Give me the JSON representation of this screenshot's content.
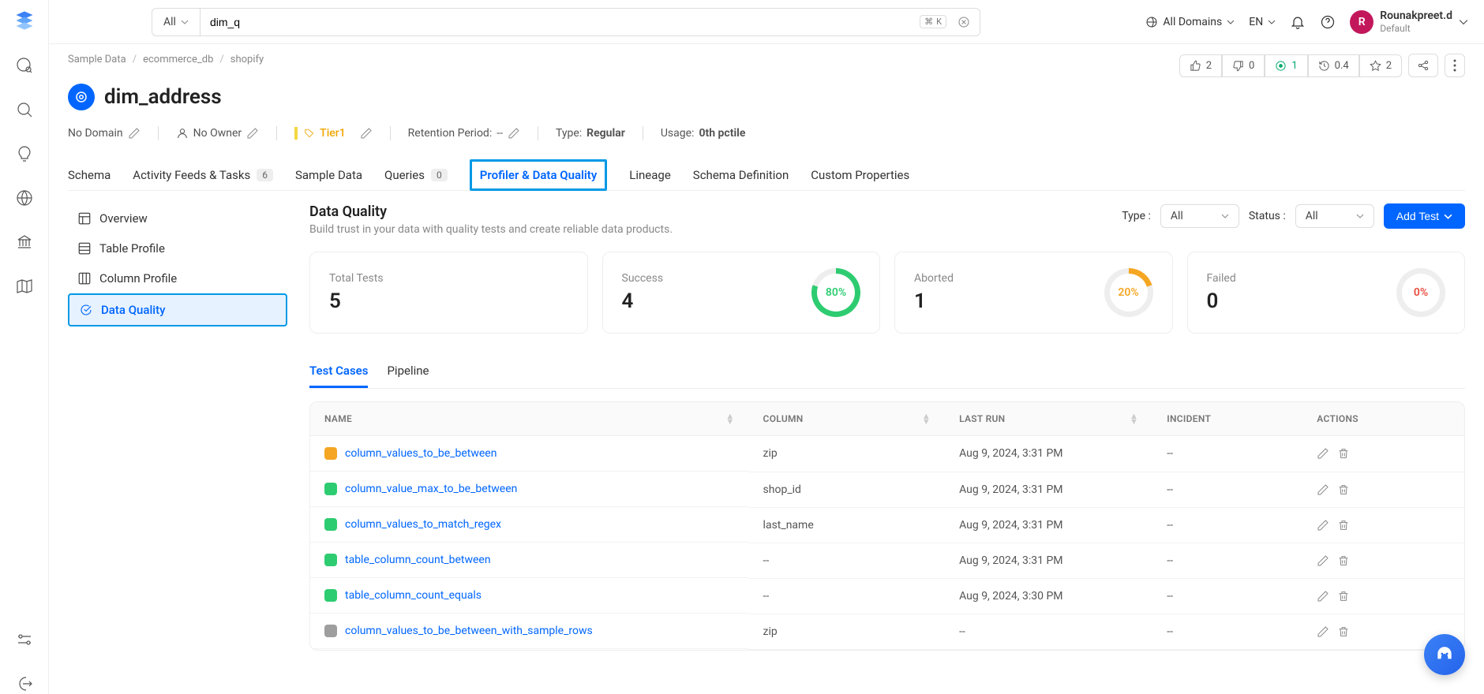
{
  "topbar": {
    "search_scope": "All",
    "search_value": "dim_q",
    "domains_label": "All Domains",
    "lang": "EN",
    "user_name": "Rounakpreet.d",
    "user_role": "Default",
    "user_initial": "R"
  },
  "breadcrumb": [
    "Sample Data",
    "ecommerce_db",
    "shopify"
  ],
  "entity": {
    "name": "dim_address",
    "domain": "No Domain",
    "owner": "No Owner",
    "tier": "Tier1",
    "retention_label": "Retention Period:",
    "retention_value": "--",
    "type_label": "Type:",
    "type_value": "Regular",
    "usage_label": "Usage:",
    "usage_value": "0th pctile"
  },
  "header_stats": {
    "thumbs_up": "2",
    "thumbs_down": "0",
    "target": "1",
    "history": "0.4",
    "star": "2"
  },
  "tabs": [
    {
      "label": "Schema"
    },
    {
      "label": "Activity Feeds & Tasks",
      "badge": "6"
    },
    {
      "label": "Sample Data"
    },
    {
      "label": "Queries",
      "badge": "0"
    },
    {
      "label": "Profiler & Data Quality",
      "active": true
    },
    {
      "label": "Lineage"
    },
    {
      "label": "Schema Definition"
    },
    {
      "label": "Custom Properties"
    }
  ],
  "side_nav": [
    {
      "label": "Overview"
    },
    {
      "label": "Table Profile"
    },
    {
      "label": "Column Profile"
    },
    {
      "label": "Data Quality",
      "active": true
    }
  ],
  "dq": {
    "title": "Data Quality",
    "subtitle": "Build trust in your data with quality tests and create reliable data products.",
    "type_label": "Type :",
    "type_value": "All",
    "status_label": "Status :",
    "status_value": "All",
    "add_test": "Add Test"
  },
  "cards": {
    "total_label": "Total Tests",
    "total_value": "5",
    "success_label": "Success",
    "success_value": "4",
    "success_pct": "80%",
    "aborted_label": "Aborted",
    "aborted_value": "1",
    "aborted_pct": "20%",
    "failed_label": "Failed",
    "failed_value": "0",
    "failed_pct": "0%"
  },
  "sub_tabs": [
    "Test Cases",
    "Pipeline"
  ],
  "table": {
    "headers": [
      "NAME",
      "COLUMN",
      "LAST RUN",
      "INCIDENT",
      "ACTIONS"
    ],
    "rows": [
      {
        "status_color": "#f5a623",
        "name": "column_values_to_be_between",
        "column": "zip",
        "last_run": "Aug 9, 2024, 3:31 PM",
        "incident": "--"
      },
      {
        "status_color": "#2ecc71",
        "name": "column_value_max_to_be_between",
        "column": "shop_id",
        "last_run": "Aug 9, 2024, 3:31 PM",
        "incident": "--"
      },
      {
        "status_color": "#2ecc71",
        "name": "column_values_to_match_regex",
        "column": "last_name",
        "last_run": "Aug 9, 2024, 3:31 PM",
        "incident": "--"
      },
      {
        "status_color": "#2ecc71",
        "name": "table_column_count_between",
        "column": "--",
        "last_run": "Aug 9, 2024, 3:31 PM",
        "incident": "--"
      },
      {
        "status_color": "#2ecc71",
        "name": "table_column_count_equals",
        "column": "--",
        "last_run": "Aug 9, 2024, 3:30 PM",
        "incident": "--"
      },
      {
        "status_color": "#9e9e9e",
        "name": "column_values_to_be_between_with_sample_rows",
        "column": "zip",
        "last_run": "--",
        "incident": "--"
      }
    ]
  }
}
